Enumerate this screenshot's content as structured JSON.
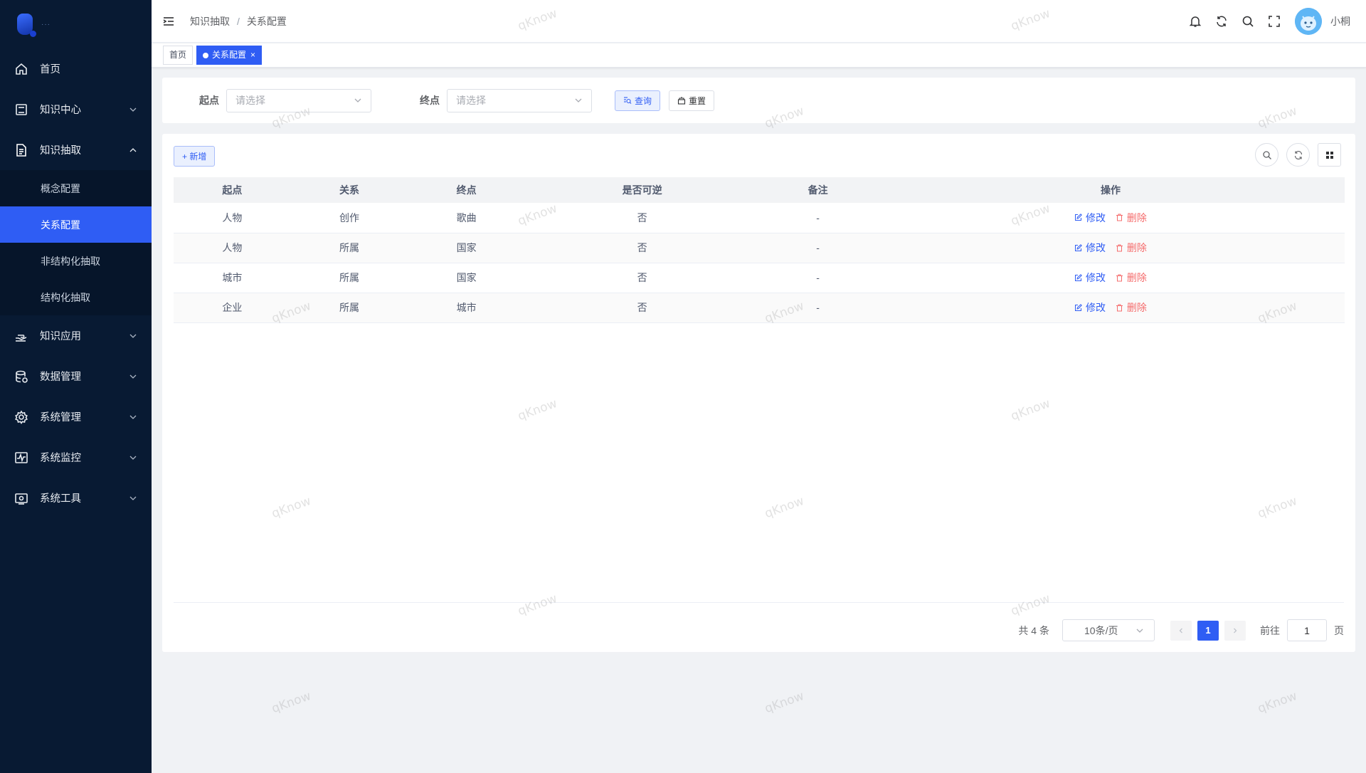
{
  "logo": {
    "text": "···"
  },
  "sidebar": {
    "items": [
      {
        "label": "首页",
        "icon": "home-icon"
      },
      {
        "label": "知识中心",
        "icon": "book-icon"
      },
      {
        "label": "知识抽取",
        "icon": "document-icon"
      },
      {
        "label": "知识应用",
        "icon": "hand-icon"
      },
      {
        "label": "数据管理",
        "icon": "database-icon"
      },
      {
        "label": "系统管理",
        "icon": "gear-icon"
      },
      {
        "label": "系统监控",
        "icon": "monitor-pulse-icon"
      },
      {
        "label": "系统工具",
        "icon": "toolbox-icon"
      }
    ],
    "submenu": [
      "概念配置",
      "关系配置",
      "非结构化抽取",
      "结构化抽取"
    ],
    "active_submenu": "关系配置"
  },
  "header": {
    "breadcrumb": [
      "知识抽取",
      "关系配置"
    ],
    "breadcrumb_sep": "/",
    "username": "小桐",
    "icons": [
      "bell-icon",
      "refresh-icon",
      "search-icon",
      "fullscreen-icon"
    ]
  },
  "tags": {
    "home": "首页",
    "active": "关系配置",
    "close": "×"
  },
  "search": {
    "start_label": "起点",
    "start_placeholder": "请选择",
    "end_label": "终点",
    "end_placeholder": "请选择",
    "query_label": "查询",
    "reset_label": "重置"
  },
  "toolbar": {
    "add_label": "+ 新增"
  },
  "table": {
    "columns": [
      "起点",
      "关系",
      "终点",
      "是否可逆",
      "备注",
      "操作"
    ],
    "rows": [
      {
        "start": "人物",
        "relation": "创作",
        "end": "歌曲",
        "reversible": "否",
        "remark": "-"
      },
      {
        "start": "人物",
        "relation": "所属",
        "end": "国家",
        "reversible": "否",
        "remark": "-"
      },
      {
        "start": "城市",
        "relation": "所属",
        "end": "国家",
        "reversible": "否",
        "remark": "-"
      },
      {
        "start": "企业",
        "relation": "所属",
        "end": "城市",
        "reversible": "否",
        "remark": "-"
      }
    ],
    "edit_label": "修改",
    "delete_label": "删除"
  },
  "pagination": {
    "total": "共 4 条",
    "page_size": "10条/页",
    "current_page": "1",
    "goto_label": "前往",
    "goto_value": "1",
    "page_suffix": "页"
  },
  "watermark": "qKnow",
  "colors": {
    "primary": "#2f5df4",
    "sidebar_bg": "#081a33",
    "danger": "#f56c6c"
  }
}
